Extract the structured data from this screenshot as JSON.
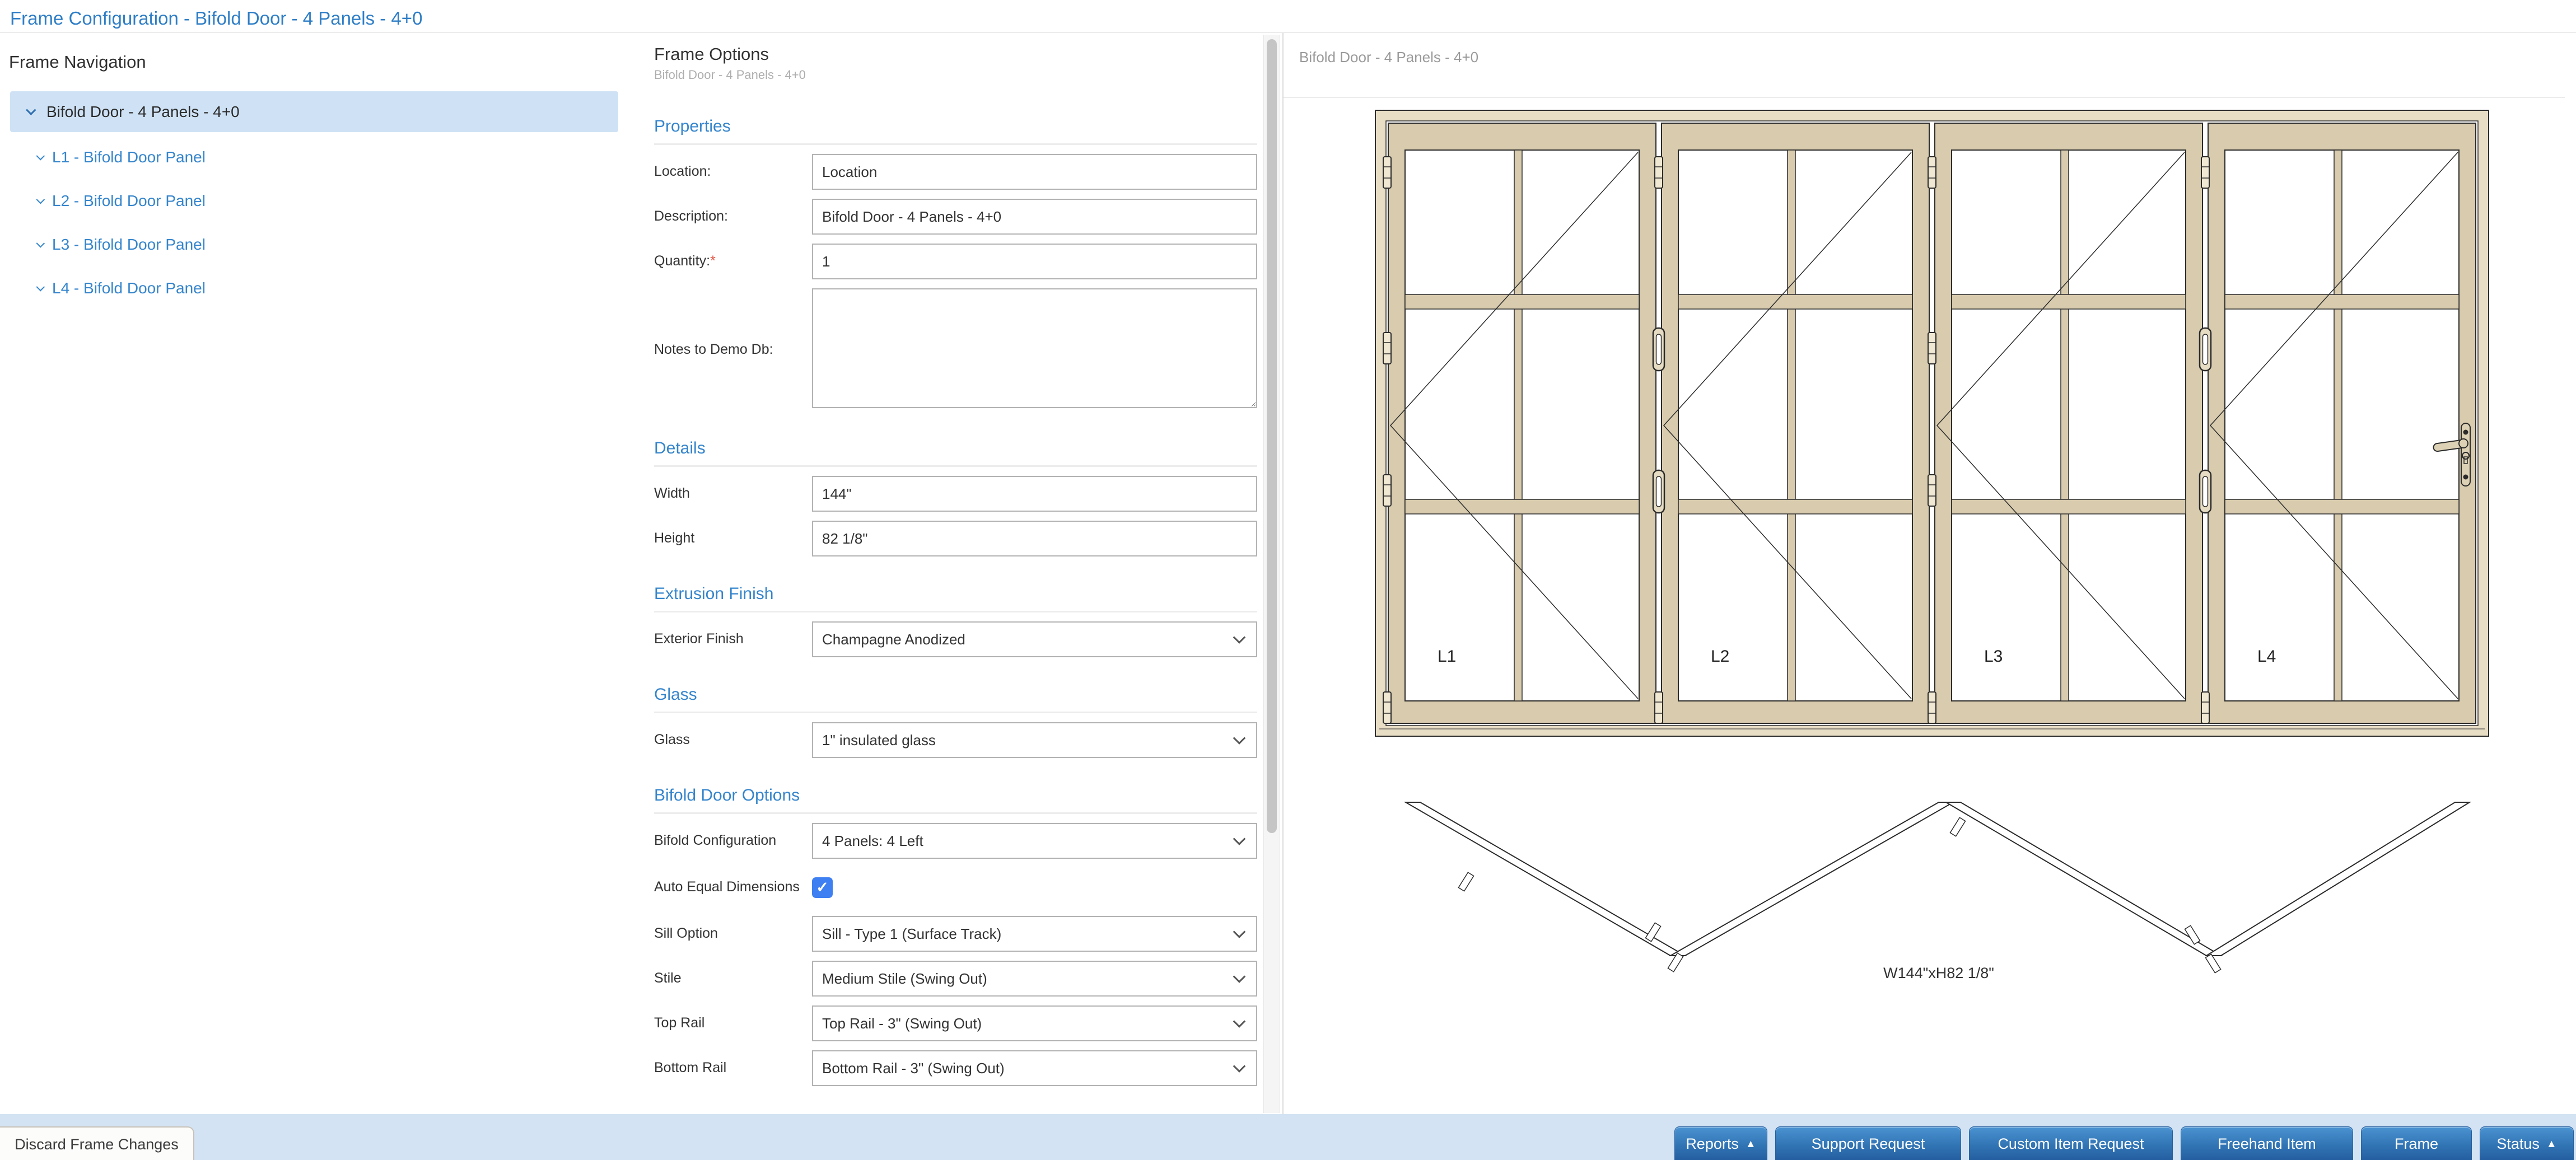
{
  "page_title": "Frame Configuration - Bifold Door - 4 Panels - 4+0",
  "nav": {
    "title": "Frame Navigation",
    "root": {
      "label": "Bifold Door - 4 Panels - 4+0",
      "selected": true
    },
    "children": [
      {
        "label": "L1 - Bifold Door Panel"
      },
      {
        "label": "L2 - Bifold Door Panel"
      },
      {
        "label": "L3 - Bifold Door Panel"
      },
      {
        "label": "L4 - Bifold Door Panel"
      }
    ]
  },
  "options": {
    "title": "Frame Options",
    "subtitle": "Bifold Door - 4 Panels - 4+0",
    "properties": {
      "heading": "Properties",
      "location_label": "Location:",
      "location_value": "Location",
      "description_label": "Description:",
      "description_value": "Bifold Door - 4 Panels - 4+0",
      "quantity_label": "Quantity:",
      "required_mark": "*",
      "quantity_value": "1",
      "notes_label": "Notes to Demo Db:",
      "notes_value": ""
    },
    "details": {
      "heading": "Details",
      "width_label": "Width",
      "width_value": "144\"",
      "height_label": "Height",
      "height_value": "82 1/8\""
    },
    "extrusion": {
      "heading": "Extrusion Finish",
      "exterior_label": "Exterior Finish",
      "exterior_value": "Champagne Anodized"
    },
    "glass": {
      "heading": "Glass",
      "glass_label": "Glass",
      "glass_value": "1\" insulated glass"
    },
    "bifold": {
      "heading": "Bifold Door Options",
      "config_label": "Bifold Configuration",
      "config_value": "4 Panels: 4 Left",
      "auto_label": "Auto Equal Dimensions",
      "auto_checked": true,
      "sill_label": "Sill Option",
      "sill_value": "Sill - Type 1 (Surface Track)",
      "stile_label": "Stile",
      "stile_value": "Medium Stile (Swing Out)",
      "top_rail_label": "Top Rail",
      "top_rail_value": "Top Rail - 3\" (Swing Out)",
      "bottom_rail_label": "Bottom Rail",
      "bottom_rail_value": "Bottom Rail - 3\" (Swing Out)"
    }
  },
  "preview": {
    "title": "Bifold Door - 4 Panels - 4+0",
    "panel_labels": [
      "L1",
      "L2",
      "L3",
      "L4"
    ],
    "dimension_label": "W144\"xH82 1/8\""
  },
  "footer": {
    "discard_label": "Discard Frame Changes",
    "buttons": [
      {
        "label": "Reports",
        "arrow": "▲"
      },
      {
        "label": "Support Request"
      },
      {
        "label": "Custom Item Request"
      },
      {
        "label": "Freehand Item"
      },
      {
        "label": "Frame"
      },
      {
        "label": "Status",
        "arrow": "▲"
      }
    ]
  },
  "icons": {
    "checkmark": "✓"
  },
  "colors": {
    "accent_blue": "#3585cc",
    "title_blue": "#2e7ec6",
    "selection_bg": "#cfe2f5",
    "footer_bg": "#d3e3f3",
    "button_blue": "#3174b4",
    "checkbox_blue": "#3e7ff2",
    "required_red": "#e04e39",
    "frame_tan_light": "#e8dec6",
    "frame_tan_mid": "#d8cbae"
  }
}
